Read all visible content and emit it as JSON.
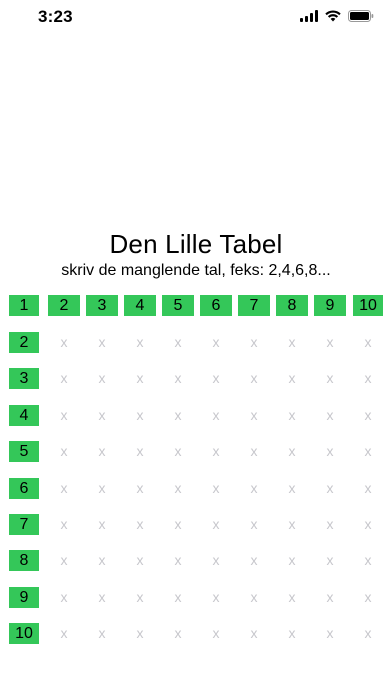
{
  "status_bar": {
    "time": "3:23"
  },
  "title": "Den Lille Tabel",
  "subtitle": "skriv de manglende tal, feks: 2,4,6,8...",
  "header_row": [
    "1",
    "2",
    "3",
    "4",
    "5",
    "6",
    "7",
    "8",
    "9",
    "10"
  ],
  "row_labels": [
    "2",
    "3",
    "4",
    "5",
    "6",
    "7",
    "8",
    "9",
    "10"
  ],
  "placeholder_mark": "x",
  "colors": {
    "accent": "#34c759",
    "placeholder": "#c7c7cc"
  }
}
